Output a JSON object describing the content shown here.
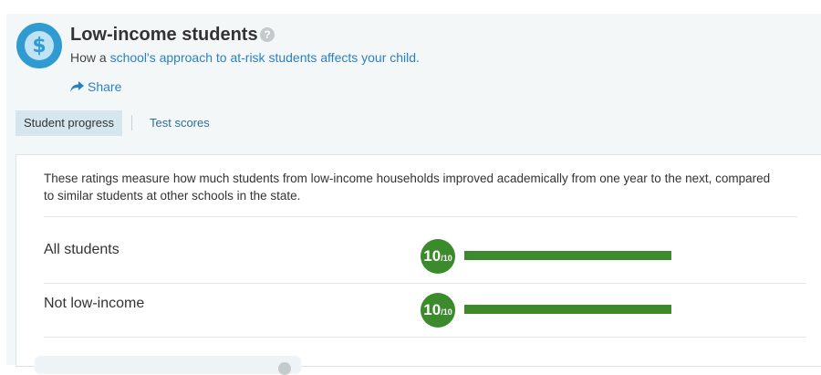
{
  "header": {
    "icon": "dollar-icon",
    "title": "Low-income students",
    "help_symbol": "?",
    "subtitle_prefix": "How a ",
    "subtitle_link": "school's approach to at-risk students affects your child.",
    "share_label": "Share"
  },
  "tabs": [
    {
      "label": "Student progress",
      "active": true
    },
    {
      "label": "Test scores",
      "active": false
    }
  ],
  "description": "These ratings measure how much students from low-income households improved academically from one year to the next, compared to similar students at other schools in the state.",
  "ratings": [
    {
      "label": "All students",
      "score": "10",
      "out_of": "/10",
      "fraction": 1.0
    },
    {
      "label": "Not low-income",
      "score": "10",
      "out_of": "/10",
      "fraction": 1.0
    }
  ],
  "colors": {
    "accent_blue": "#2f9bd1",
    "link_blue": "#2b80c2",
    "rating_green": "#3b8a2c"
  }
}
